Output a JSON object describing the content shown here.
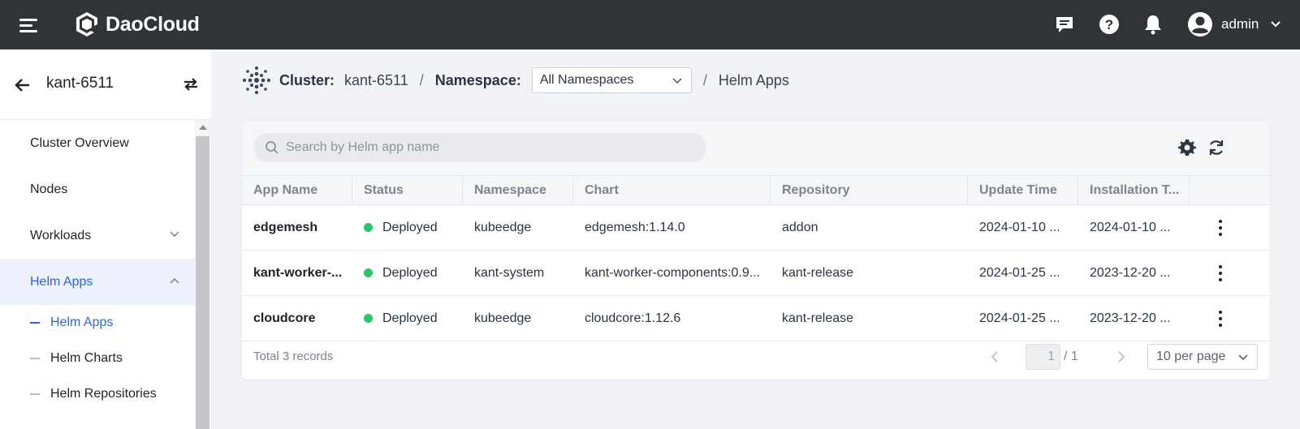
{
  "topbar": {
    "brand": "DaoCloud",
    "user_name": "admin",
    "icons": [
      "menu-icon",
      "message-icon",
      "help-icon",
      "bell-icon",
      "user-avatar-icon",
      "chevron-down-icon"
    ]
  },
  "sidebar": {
    "cluster_name": "kant-6511",
    "items": [
      {
        "label": "Cluster Overview"
      },
      {
        "label": "Nodes"
      },
      {
        "label": "Workloads"
      },
      {
        "label": "Helm Apps"
      }
    ],
    "sub_items": [
      {
        "label": "Helm Apps"
      },
      {
        "label": "Helm Charts"
      },
      {
        "label": "Helm Repositories"
      }
    ]
  },
  "breadcrumb": {
    "cluster_label": "Cluster:",
    "cluster_value": "kant-6511",
    "separator": "/",
    "namespace_label": "Namespace:",
    "namespace_value": "All Namespaces",
    "page": "Helm Apps"
  },
  "search": {
    "placeholder": "Search by Helm app name"
  },
  "table": {
    "columns": [
      "App Name",
      "Status",
      "Namespace",
      "Chart",
      "Repository",
      "Update Time",
      "Installation T..."
    ],
    "rows": [
      {
        "name": "edgemesh",
        "status": "Deployed",
        "namespace": "kubeedge",
        "chart": "edgemesh:1.14.0",
        "repository": "addon",
        "update_time": "2024-01-10 ...",
        "install_time": "2024-01-10 ..."
      },
      {
        "name": "kant-worker-...",
        "status": "Deployed",
        "namespace": "kant-system",
        "chart": "kant-worker-components:0.9...",
        "repository": "kant-release",
        "update_time": "2024-01-25 ...",
        "install_time": "2023-12-20 ..."
      },
      {
        "name": "cloudcore",
        "status": "Deployed",
        "namespace": "kubeedge",
        "chart": "cloudcore:1.12.6",
        "repository": "kant-release",
        "update_time": "2024-01-25 ...",
        "install_time": "2023-12-20 ..."
      }
    ]
  },
  "pagination": {
    "total_text": "Total 3 records",
    "current_page": "1",
    "total_pages": "/ 1",
    "page_size": "10 per page"
  },
  "colors": {
    "topbar_bg": "#303338",
    "accent": "#2c64e3",
    "status_deployed": "#27c46b"
  }
}
